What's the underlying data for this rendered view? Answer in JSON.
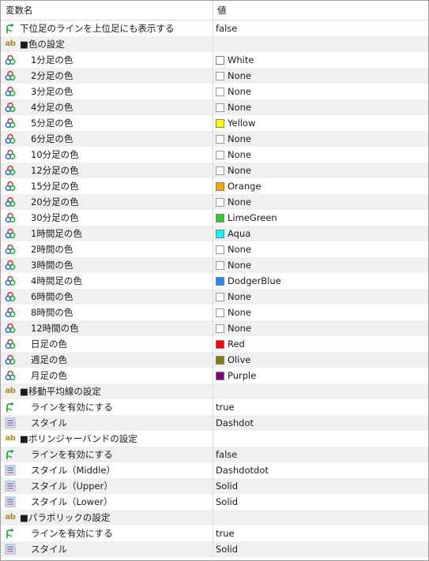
{
  "header": {
    "name_col": "変数名",
    "value_col": "値"
  },
  "colors": {
    "White": "#ffffff",
    "None": "#ffffff",
    "Yellow": "#ffff00",
    "Orange": "#ffa500",
    "LimeGreen": "#32cd32",
    "Aqua": "#00ffff",
    "DodgerBlue": "#1e90ff",
    "Red": "#ff0000",
    "Olive": "#808000",
    "Purple": "#800080"
  },
  "rows": [
    {
      "type": "bool",
      "label": "下位足のラインを上位足にも表示する",
      "value": "false",
      "indent": false,
      "icon": "bool-arrow-icon"
    },
    {
      "type": "section",
      "label": "■色の設定",
      "value": "",
      "icon": "string-ab-icon"
    },
    {
      "type": "color",
      "label": "1分足の色",
      "value": "White",
      "indent": true,
      "icon": "color-palette-icon"
    },
    {
      "type": "color",
      "label": "2分足の色",
      "value": "None",
      "indent": true,
      "icon": "color-palette-icon"
    },
    {
      "type": "color",
      "label": "3分足の色",
      "value": "None",
      "indent": true,
      "icon": "color-palette-icon"
    },
    {
      "type": "color",
      "label": "4分足の色",
      "value": "None",
      "indent": true,
      "icon": "color-palette-icon"
    },
    {
      "type": "color",
      "label": "5分足の色",
      "value": "Yellow",
      "indent": true,
      "icon": "color-palette-icon"
    },
    {
      "type": "color",
      "label": "6分足の色",
      "value": "None",
      "indent": true,
      "icon": "color-palette-icon"
    },
    {
      "type": "color",
      "label": "10分足の色",
      "value": "None",
      "indent": true,
      "icon": "color-palette-icon"
    },
    {
      "type": "color",
      "label": "12分足の色",
      "value": "None",
      "indent": true,
      "icon": "color-palette-icon"
    },
    {
      "type": "color",
      "label": "15分足の色",
      "value": "Orange",
      "indent": true,
      "icon": "color-palette-icon"
    },
    {
      "type": "color",
      "label": "20分足の色",
      "value": "None",
      "indent": true,
      "icon": "color-palette-icon"
    },
    {
      "type": "color",
      "label": "30分足の色",
      "value": "LimeGreen",
      "indent": true,
      "icon": "color-palette-icon"
    },
    {
      "type": "color",
      "label": "1時間足の色",
      "value": "Aqua",
      "indent": true,
      "icon": "color-palette-icon"
    },
    {
      "type": "color",
      "label": "2時間の色",
      "value": "None",
      "indent": true,
      "icon": "color-palette-icon"
    },
    {
      "type": "color",
      "label": "3時間の色",
      "value": "None",
      "indent": true,
      "icon": "color-palette-icon"
    },
    {
      "type": "color",
      "label": "4時間足の色",
      "value": "DodgerBlue",
      "indent": true,
      "icon": "color-palette-icon"
    },
    {
      "type": "color",
      "label": "6時間の色",
      "value": "None",
      "indent": true,
      "icon": "color-palette-icon"
    },
    {
      "type": "color",
      "label": "8時間の色",
      "value": "None",
      "indent": true,
      "icon": "color-palette-icon"
    },
    {
      "type": "color",
      "label": "12時間の色",
      "value": "None",
      "indent": true,
      "icon": "color-palette-icon"
    },
    {
      "type": "color",
      "label": "日足の色",
      "value": "Red",
      "indent": true,
      "icon": "color-palette-icon"
    },
    {
      "type": "color",
      "label": "週足の色",
      "value": "Olive",
      "indent": true,
      "icon": "color-palette-icon"
    },
    {
      "type": "color",
      "label": "月足の色",
      "value": "Purple",
      "indent": true,
      "icon": "color-palette-icon"
    },
    {
      "type": "section",
      "label": "■移動平均線の設定",
      "value": "",
      "icon": "string-ab-icon"
    },
    {
      "type": "bool",
      "label": "ラインを有効にする",
      "value": "true",
      "indent": true,
      "icon": "bool-arrow-icon"
    },
    {
      "type": "enum",
      "label": "スタイル",
      "value": "Dashdot",
      "indent": true,
      "icon": "line-style-icon"
    },
    {
      "type": "section",
      "label": "■ボリンジャーバンドの設定",
      "value": "",
      "icon": "string-ab-icon"
    },
    {
      "type": "bool",
      "label": "ラインを有効にする",
      "value": "false",
      "indent": true,
      "icon": "bool-arrow-icon"
    },
    {
      "type": "enum",
      "label": "スタイル（Middle）",
      "value": "Dashdotdot",
      "indent": true,
      "icon": "line-style-icon"
    },
    {
      "type": "enum",
      "label": "スタイル（Upper）",
      "value": "Solid",
      "indent": true,
      "icon": "line-style-icon"
    },
    {
      "type": "enum",
      "label": "スタイル（Lower）",
      "value": "Solid",
      "indent": true,
      "icon": "line-style-icon"
    },
    {
      "type": "section",
      "label": "■パラボリックの設定",
      "value": "",
      "icon": "string-ab-icon"
    },
    {
      "type": "bool",
      "label": "ラインを有効にする",
      "value": "true",
      "indent": true,
      "icon": "bool-arrow-icon"
    },
    {
      "type": "enum",
      "label": "スタイル",
      "value": "Solid",
      "indent": true,
      "icon": "line-style-icon"
    }
  ]
}
